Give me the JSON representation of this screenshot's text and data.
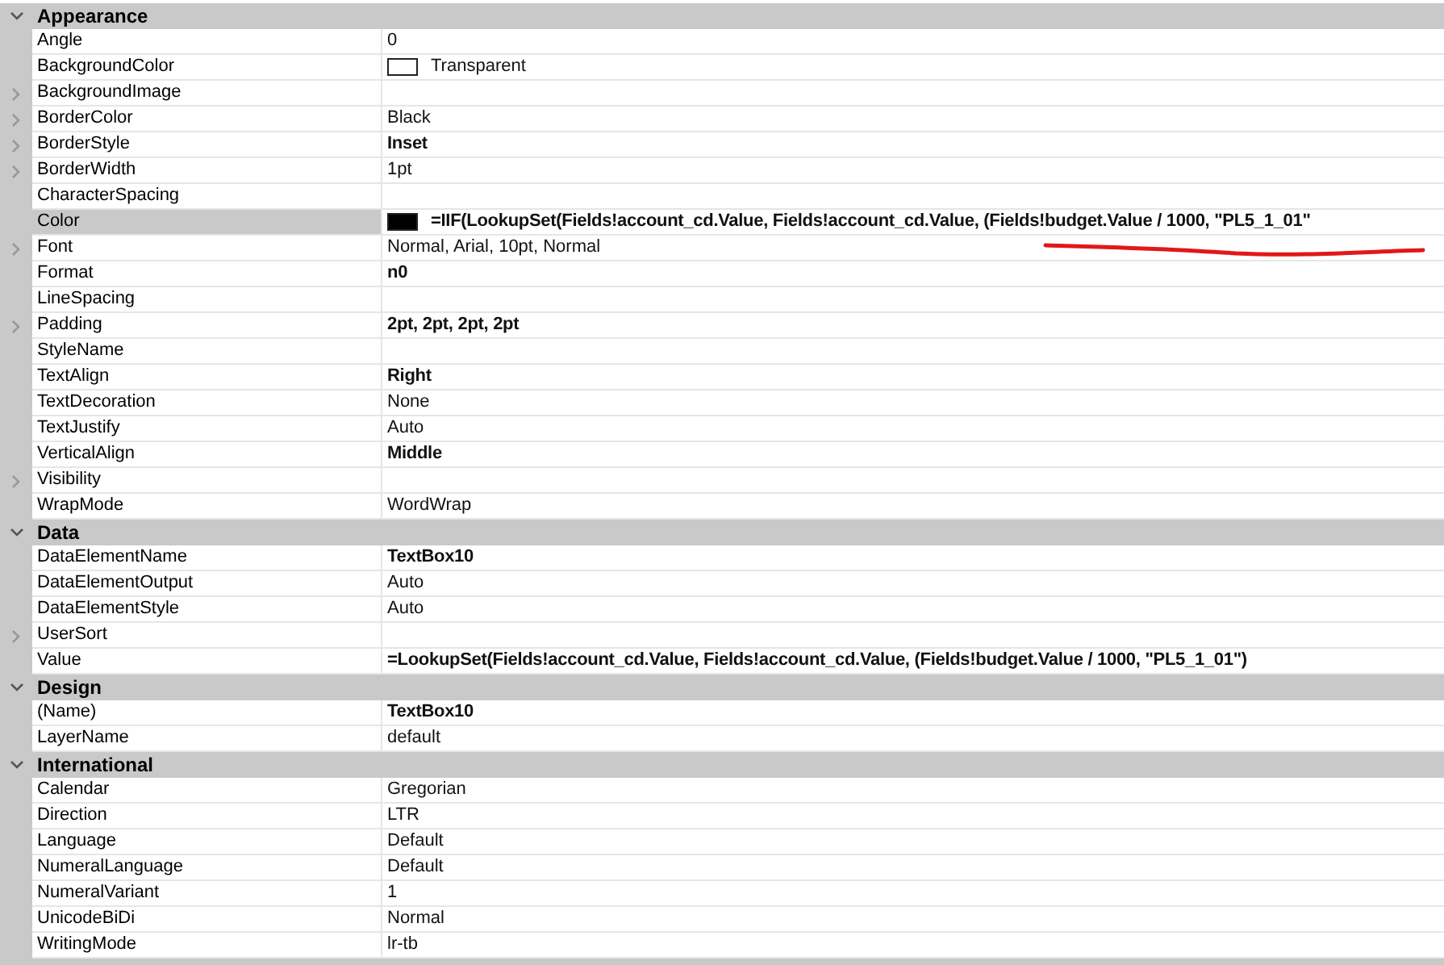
{
  "categories": [
    {
      "name": "Appearance",
      "expanded": true,
      "properties": [
        {
          "name": "Angle",
          "value": "0",
          "bold": false,
          "expandable": false,
          "selected": false
        },
        {
          "name": "BackgroundColor",
          "value": "Transparent",
          "bold": false,
          "expandable": false,
          "selected": false,
          "color": "#ffffff"
        },
        {
          "name": "BackgroundImage",
          "expandable": true,
          "selected": false
        },
        {
          "name": "BorderColor",
          "value": "Black",
          "bold": false,
          "expandable": true,
          "selected": false
        },
        {
          "name": "BorderStyle",
          "value": "Inset",
          "bold": true,
          "expandable": true,
          "selected": false
        },
        {
          "name": "BorderWidth",
          "value": "1pt",
          "bold": false,
          "expandable": true,
          "selected": false
        },
        {
          "name": "CharacterSpacing",
          "expandable": false,
          "selected": false
        },
        {
          "name": "Color",
          "value": "=IIF(LookupSet(Fields!account_cd.Value, Fields!account_cd.Value, (Fields!budget.Value / 1000, \"PL5_1_01\"",
          "bold": true,
          "expandable": false,
          "selected": true,
          "color": "#000000"
        },
        {
          "name": "Font",
          "value": "Normal, Arial, 10pt, Normal",
          "bold": false,
          "expandable": true,
          "selected": false
        },
        {
          "name": "Format",
          "value": "n0",
          "bold": true,
          "expandable": false,
          "selected": false
        },
        {
          "name": "LineSpacing",
          "expandable": false,
          "selected": false
        },
        {
          "name": "Padding",
          "value": "2pt, 2pt, 2pt, 2pt",
          "bold": true,
          "expandable": true,
          "selected": false
        },
        {
          "name": "StyleName",
          "expandable": false,
          "selected": false
        },
        {
          "name": "TextAlign",
          "value": "Right",
          "bold": true,
          "expandable": false,
          "selected": false
        },
        {
          "name": "TextDecoration",
          "value": "None",
          "bold": false,
          "expandable": false,
          "selected": false
        },
        {
          "name": "TextJustify",
          "value": "Auto",
          "bold": false,
          "expandable": false,
          "selected": false
        },
        {
          "name": "VerticalAlign",
          "value": "Middle",
          "bold": true,
          "expandable": false,
          "selected": false
        },
        {
          "name": "Visibility",
          "expandable": true,
          "selected": false
        },
        {
          "name": "WrapMode",
          "value": "WordWrap",
          "bold": false,
          "expandable": false,
          "selected": false
        }
      ]
    },
    {
      "name": "Data",
      "expanded": true,
      "properties": [
        {
          "name": "DataElementName",
          "value": "TextBox10",
          "bold": true,
          "expandable": false,
          "selected": false
        },
        {
          "name": "DataElementOutput",
          "value": "Auto",
          "bold": false,
          "expandable": false,
          "selected": false
        },
        {
          "name": "DataElementStyle",
          "value": "Auto",
          "bold": false,
          "expandable": false,
          "selected": false
        },
        {
          "name": "UserSort",
          "expandable": true,
          "selected": false
        },
        {
          "name": "Value",
          "value": "=LookupSet(Fields!account_cd.Value, Fields!account_cd.Value, (Fields!budget.Value / 1000, \"PL5_1_01\")",
          "bold": true,
          "expandable": false,
          "selected": false
        }
      ]
    },
    {
      "name": "Design",
      "expanded": true,
      "properties": [
        {
          "name": "(Name)",
          "value": "TextBox10",
          "bold": true,
          "expandable": false,
          "selected": false
        },
        {
          "name": "LayerName",
          "value": "default",
          "bold": false,
          "expandable": false,
          "selected": false
        }
      ]
    },
    {
      "name": "International",
      "expanded": true,
      "properties": [
        {
          "name": "Calendar",
          "value": "Gregorian",
          "bold": false,
          "expandable": false,
          "selected": false
        },
        {
          "name": "Direction",
          "value": "LTR",
          "bold": false,
          "expandable": false,
          "selected": false
        },
        {
          "name": "Language",
          "value": "Default",
          "bold": false,
          "expandable": false,
          "selected": false
        },
        {
          "name": "NumeralLanguage",
          "value": "Default",
          "bold": false,
          "expandable": false,
          "selected": false
        },
        {
          "name": "NumeralVariant",
          "value": "1",
          "bold": false,
          "expandable": false,
          "selected": false
        },
        {
          "name": "UnicodeBiDi",
          "value": "Normal",
          "bold": false,
          "expandable": false,
          "selected": false
        },
        {
          "name": "WritingMode",
          "value": "lr-tb",
          "bold": false,
          "expandable": false,
          "selected": false
        }
      ]
    }
  ]
}
